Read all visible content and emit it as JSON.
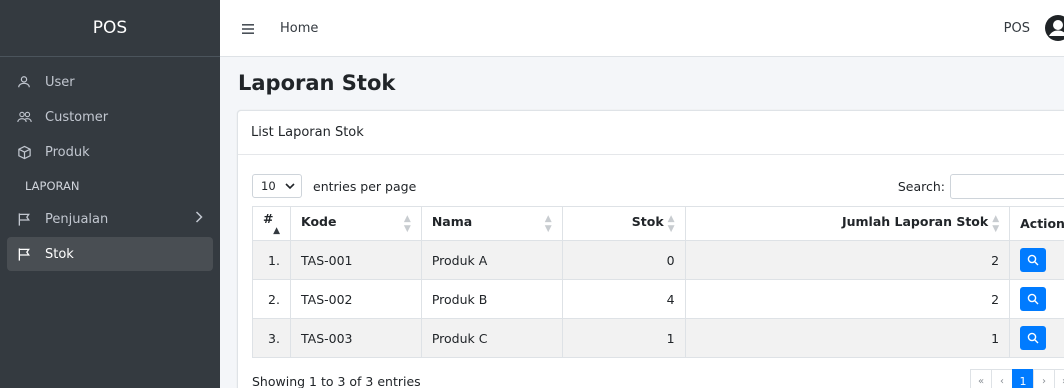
{
  "sidebar": {
    "brand": "POS",
    "items": [
      {
        "label": "User",
        "icon": "user-icon"
      },
      {
        "label": "Customer",
        "icon": "users-icon"
      },
      {
        "label": "Produk",
        "icon": "box-icon"
      }
    ],
    "section_header": "LAPORAN",
    "laporan_items": [
      {
        "label": "Penjualan",
        "icon": "flag-icon",
        "has_submenu": true
      },
      {
        "label": "Stok",
        "icon": "flag-icon",
        "active": true
      }
    ]
  },
  "topbar": {
    "home_label": "Home",
    "right_label": "POS"
  },
  "page": {
    "title": "Laporan Stok",
    "card_title": "List Laporan Stok"
  },
  "table_controls": {
    "per_page_value": "10",
    "per_page_label": "entries per page",
    "search_label": "Search:",
    "search_value": ""
  },
  "table": {
    "columns": [
      "#",
      "Kode",
      "Nama",
      "Stok",
      "Jumlah Laporan Stok",
      "Action"
    ],
    "rows": [
      {
        "no": "1.",
        "kode": "TAS-001",
        "nama": "Produk A",
        "stok": "0",
        "jumlah": "2"
      },
      {
        "no": "2.",
        "kode": "TAS-002",
        "nama": "Produk B",
        "stok": "4",
        "jumlah": "2"
      },
      {
        "no": "3.",
        "kode": "TAS-003",
        "nama": "Produk C",
        "stok": "1",
        "jumlah": "1"
      }
    ]
  },
  "footer": {
    "info": "Showing 1 to 3 of 3 entries",
    "pagination": [
      "«",
      "‹",
      "1",
      "›",
      "»"
    ],
    "current_page": "1"
  },
  "colors": {
    "sidebar_bg": "#343a40",
    "primary": "#007bff"
  }
}
